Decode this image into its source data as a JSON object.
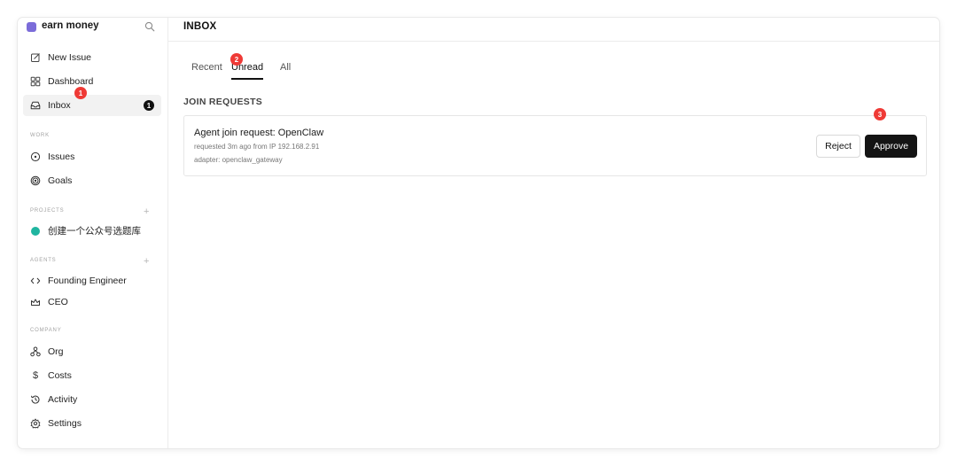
{
  "workspace": {
    "name": "earn money",
    "color": "#7b6cd9",
    "search_icon": "search-icon"
  },
  "sidebar": {
    "top_items": [
      {
        "label": "New Issue",
        "icon": "edit-icon"
      },
      {
        "label": "Dashboard",
        "icon": "grid-icon"
      },
      {
        "label": "Inbox",
        "icon": "inbox-icon",
        "badge": "1",
        "active": true
      }
    ],
    "sections": {
      "work": {
        "label": "WORK",
        "items": [
          {
            "label": "Issues",
            "icon": "circle-dot-icon"
          },
          {
            "label": "Goals",
            "icon": "target-icon"
          }
        ]
      },
      "projects": {
        "label": "PROJECTS",
        "plus": "+",
        "items": [
          {
            "label": "创建一个公众号选题库",
            "color": "#1fb5a0"
          }
        ]
      },
      "agents": {
        "label": "AGENTS",
        "plus": "+",
        "items": [
          {
            "label": "Founding Engineer",
            "icon": "code-icon"
          },
          {
            "label": "CEO",
            "icon": "crown-icon"
          }
        ]
      },
      "company": {
        "label": "COMPANY",
        "items": [
          {
            "label": "Org",
            "icon": "org-chart-icon"
          },
          {
            "label": "Costs",
            "icon": "dollar-icon"
          },
          {
            "label": "Activity",
            "icon": "history-icon"
          },
          {
            "label": "Settings",
            "icon": "gear-icon"
          }
        ]
      }
    }
  },
  "main": {
    "title": "INBOX",
    "tabs": [
      {
        "label": "Recent"
      },
      {
        "label": "Unread",
        "active": true
      },
      {
        "label": "All"
      }
    ],
    "group_label": "JOIN REQUESTS",
    "request": {
      "title": "Agent join request: OpenClaw",
      "subtitle": "requested 3m ago from IP 192.168.2.91",
      "adapter": "adapter: openclaw_gateway",
      "reject_label": "Reject",
      "approve_label": "Approve"
    }
  },
  "markers": [
    "1",
    "2",
    "3"
  ],
  "colors": {
    "marker": "#ef3a36",
    "approve_bg": "#141414"
  }
}
